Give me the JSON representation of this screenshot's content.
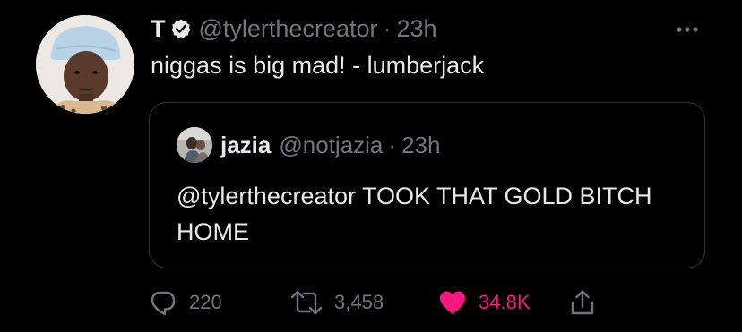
{
  "tweet": {
    "author": {
      "display_name": "T",
      "handle": "@tylerthecreator",
      "time": "23h",
      "separator": "·"
    },
    "text": "niggas is big mad! - lumberjack",
    "quote": {
      "display_name": "jazia",
      "handle": "@notjazia",
      "time": "23h",
      "separator": "·",
      "text": "@tylerthecreator TOOK THAT GOLD BITCH HOME"
    },
    "actions": {
      "replies": "220",
      "retweets": "3,458",
      "likes": "34.8K"
    }
  },
  "icons": {
    "verified": "verified-badge-icon",
    "more": "more-horizontal-icon",
    "reply": "reply-bubble-icon",
    "retweet": "retweet-arrows-icon",
    "like": "heart-icon",
    "share": "share-upload-icon"
  },
  "colors": {
    "background": "#000000",
    "text_primary": "#e7e9ea",
    "text_secondary": "#71767b",
    "border": "#2f3336",
    "like_active": "#f91880",
    "verified_badge": "#e7e9ea"
  },
  "state": {
    "liked": true
  }
}
